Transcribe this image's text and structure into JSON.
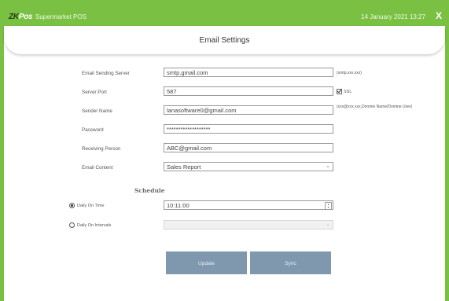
{
  "header": {
    "logo_zk": "ZK",
    "logo_pos": "Pos",
    "app_title": "Supermarket POS",
    "datetime": "14 January 2021 13:27",
    "close_label": "X"
  },
  "page": {
    "title": "Email Settings"
  },
  "form": {
    "email_server": {
      "label": "Email Sending Server",
      "value": "smtp.gmail.com",
      "hint": "(smtp.xxx.xxx)"
    },
    "server_port": {
      "label": "Server Port",
      "value": "587",
      "ssl_label": "SSL",
      "ssl_checked": true
    },
    "sender_name": {
      "label": "Sender Name",
      "value": "lanasoftware0@gmail.com",
      "hint": "(xxx@xxx.xxx,Domine Name/Domine User)"
    },
    "password": {
      "label": "Password",
      "value": "*******************"
    },
    "receiving_person": {
      "label": "Receiving Person",
      "value": "ABC@gmail.com"
    },
    "email_content": {
      "label": "Email Content",
      "value": "Sales Report"
    }
  },
  "schedule": {
    "title": "Schedule",
    "daily_on_time": {
      "label": "Daily On Time",
      "selected": true,
      "value": "10:11:00"
    },
    "daily_on_intervals": {
      "label": "Daily On Intervals",
      "selected": false,
      "value": ""
    }
  },
  "buttons": {
    "update": "Update",
    "sync": "Sync"
  },
  "colors": {
    "topbar": "#7ac143",
    "button": "#7f98ad"
  }
}
